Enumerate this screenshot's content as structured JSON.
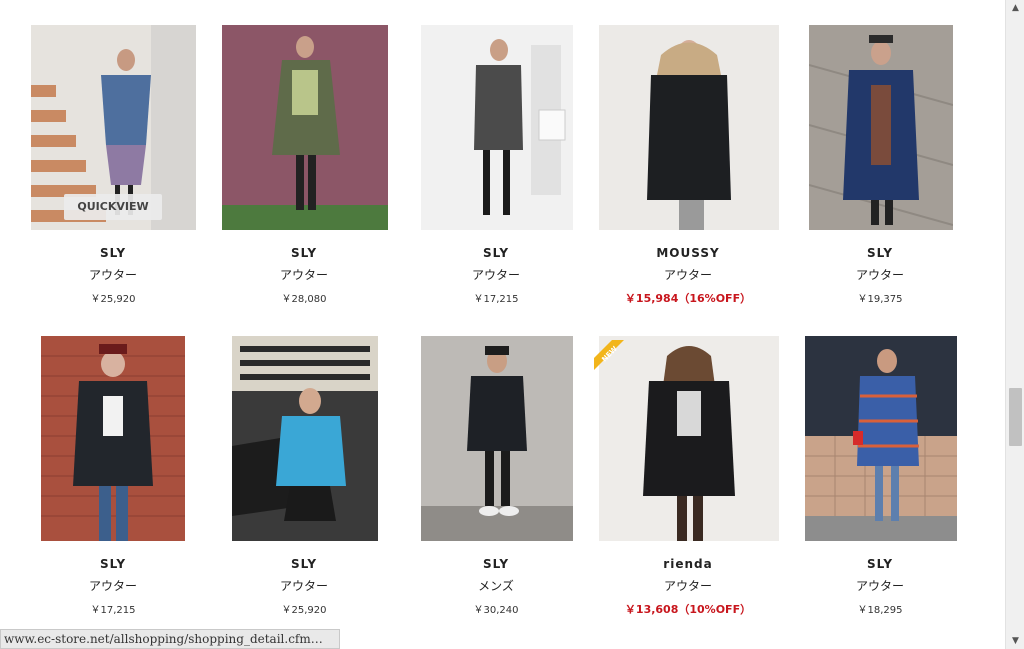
{
  "products": [
    {
      "brand": "SLY",
      "category": "アウター",
      "price": "￥25,920",
      "sale": false
    },
    {
      "brand": "SLY",
      "category": "アウター",
      "price": "￥28,080",
      "sale": false
    },
    {
      "brand": "SLY",
      "category": "アウター",
      "price": "￥17,215",
      "sale": false
    },
    {
      "brand": "MOUSSY",
      "category": "アウター",
      "price": "￥15,984（16%OFF）",
      "sale": true
    },
    {
      "brand": "SLY",
      "category": "アウター",
      "price": "￥19,375",
      "sale": false
    },
    {
      "brand": "SLY",
      "category": "アウター",
      "price": "￥17,215",
      "sale": false
    },
    {
      "brand": "SLY",
      "category": "アウター",
      "price": "￥25,920",
      "sale": false
    },
    {
      "brand": "SLY",
      "category": "メンズ",
      "price": "￥30,240",
      "sale": false
    },
    {
      "brand": "rienda",
      "category": "アウター",
      "price": "￥13,608（10%OFF）",
      "sale": true
    },
    {
      "brand": "SLY",
      "category": "アウター",
      "price": "￥18,295",
      "sale": false
    }
  ],
  "quickview_label": "QUICKVIEW",
  "new_badge_label": "NEW",
  "status_url": "www.ec-store.net/allshopping/shopping_detail.cfm…",
  "colors": {
    "sale_price": "#c8161d",
    "new_badge": "#f2b51b"
  }
}
